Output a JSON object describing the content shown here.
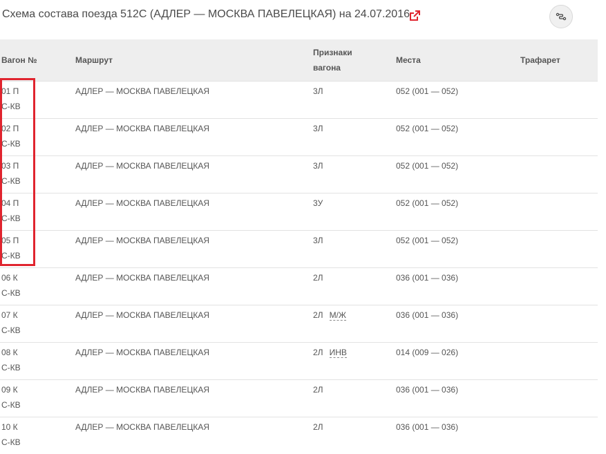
{
  "page": {
    "title": "Схема состава поезда 512С (АДЛЕР — МОСКВА ПАВЕЛЕЦКАЯ) на 24.07.2016",
    "external_link_icon": "external-link-icon",
    "route_button_icon": "route-icon",
    "accent_color": "#e0242e"
  },
  "table": {
    "headers": {
      "wagon": "Вагон №",
      "route": "Маршрут",
      "signs_line1": "Признаки",
      "signs_line2": "вагона",
      "seats": "Места",
      "stencil": "Трафарет"
    },
    "rows": [
      {
        "wagon": "01 П",
        "wagon_sub": "С-КВ",
        "route": "АДЛЕР — МОСКВА ПАВЕЛЕЦКАЯ",
        "sign": "3Л",
        "sign_extra": "",
        "seats": "052 (001 — 052)",
        "stencil": ""
      },
      {
        "wagon": "02 П",
        "wagon_sub": "С-КВ",
        "route": "АДЛЕР — МОСКВА ПАВЕЛЕЦКАЯ",
        "sign": "3Л",
        "sign_extra": "",
        "seats": "052 (001 — 052)",
        "stencil": ""
      },
      {
        "wagon": "03 П",
        "wagon_sub": "С-КВ",
        "route": "АДЛЕР — МОСКВА ПАВЕЛЕЦКАЯ",
        "sign": "3Л",
        "sign_extra": "",
        "seats": "052 (001 — 052)",
        "stencil": ""
      },
      {
        "wagon": "04 П",
        "wagon_sub": "С-КВ",
        "route": "АДЛЕР — МОСКВА ПАВЕЛЕЦКАЯ",
        "sign": "3У",
        "sign_extra": "",
        "seats": "052 (001 — 052)",
        "stencil": ""
      },
      {
        "wagon": "05 П",
        "wagon_sub": "С-КВ",
        "route": "АДЛЕР — МОСКВА ПАВЕЛЕЦКАЯ",
        "sign": "3Л",
        "sign_extra": "",
        "seats": "052 (001 — 052)",
        "stencil": ""
      },
      {
        "wagon": "06 К",
        "wagon_sub": "С-КВ",
        "route": "АДЛЕР — МОСКВА ПАВЕЛЕЦКАЯ",
        "sign": "2Л",
        "sign_extra": "",
        "seats": "036 (001 — 036)",
        "stencil": ""
      },
      {
        "wagon": "07 К",
        "wagon_sub": "С-КВ",
        "route": "АДЛЕР — МОСКВА ПАВЕЛЕЦКАЯ",
        "sign": "2Л",
        "sign_extra": "М/Ж",
        "seats": "036 (001 — 036)",
        "stencil": ""
      },
      {
        "wagon": "08 К",
        "wagon_sub": "С-КВ",
        "route": "АДЛЕР — МОСКВА ПАВЕЛЕЦКАЯ",
        "sign": "2Л",
        "sign_extra": "ИНВ",
        "seats": "014 (009 — 026)",
        "stencil": ""
      },
      {
        "wagon": "09 К",
        "wagon_sub": "С-КВ",
        "route": "АДЛЕР — МОСКВА ПАВЕЛЕЦКАЯ",
        "sign": "2Л",
        "sign_extra": "",
        "seats": "036 (001 — 036)",
        "stencil": ""
      },
      {
        "wagon": "10 К",
        "wagon_sub": "С-КВ",
        "route": "АДЛЕР — МОСКВА ПАВЕЛЕЦКАЯ",
        "sign": "2Л",
        "sign_extra": "",
        "seats": "036 (001 — 036)",
        "stencil": ""
      }
    ]
  }
}
